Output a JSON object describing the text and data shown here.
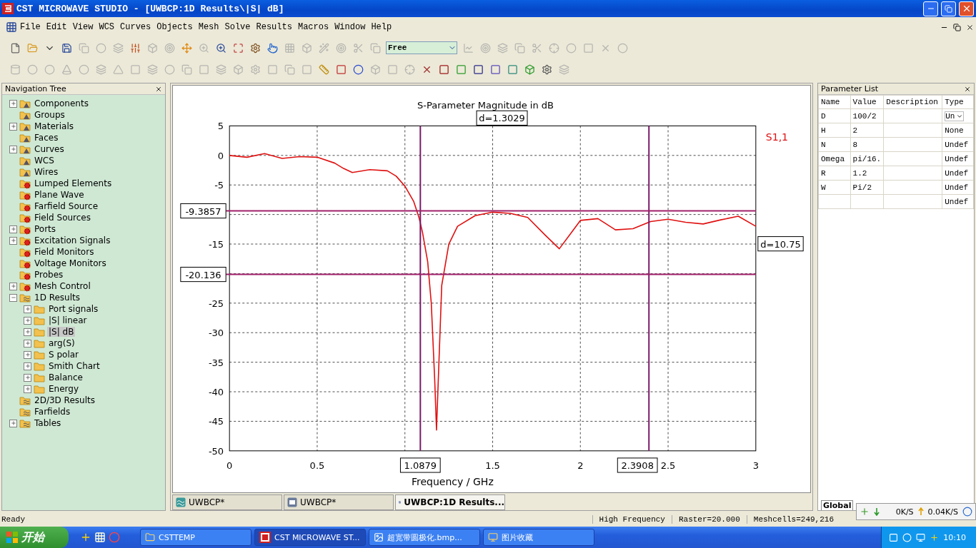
{
  "window": {
    "title": "CST MICROWAVE STUDIO - [UWBCP:1D Results\\|S| dB]"
  },
  "menu": [
    "File",
    "Edit",
    "View",
    "WCS",
    "Curves",
    "Objects",
    "Mesh",
    "Solve",
    "Results",
    "Macros",
    "Window",
    "Help"
  ],
  "toolbar": {
    "view_mode": "Free"
  },
  "navigation_tree": {
    "title": "Navigation Tree",
    "items": [
      {
        "label": "Components",
        "kind": "structure",
        "expandable": true,
        "expanded": false,
        "selected": false
      },
      {
        "label": "Groups",
        "kind": "structure",
        "expandable": false,
        "selected": false
      },
      {
        "label": "Materials",
        "kind": "structure",
        "expandable": true,
        "expanded": false,
        "selected": false
      },
      {
        "label": "Faces",
        "kind": "structure",
        "expandable": false,
        "selected": false
      },
      {
        "label": "Curves",
        "kind": "structure",
        "expandable": true,
        "expanded": false,
        "selected": false
      },
      {
        "label": "WCS",
        "kind": "structure",
        "expandable": false,
        "selected": false
      },
      {
        "label": "Wires",
        "kind": "structure",
        "expandable": false,
        "selected": false
      },
      {
        "label": "Lumped Elements",
        "kind": "source",
        "expandable": false,
        "selected": false
      },
      {
        "label": "Plane Wave",
        "kind": "source",
        "expandable": false,
        "selected": false
      },
      {
        "label": "Farfield Source",
        "kind": "source",
        "expandable": false,
        "selected": false
      },
      {
        "label": "Field Sources",
        "kind": "source",
        "expandable": false,
        "selected": false
      },
      {
        "label": "Ports",
        "kind": "source",
        "expandable": true,
        "expanded": false,
        "selected": false
      },
      {
        "label": "Excitation Signals",
        "kind": "source",
        "expandable": true,
        "expanded": false,
        "selected": false
      },
      {
        "label": "Field Monitors",
        "kind": "source",
        "expandable": false,
        "selected": false
      },
      {
        "label": "Voltage Monitors",
        "kind": "source",
        "expandable": false,
        "selected": false
      },
      {
        "label": "Probes",
        "kind": "source",
        "expandable": false,
        "selected": false
      },
      {
        "label": "Mesh Control",
        "kind": "source",
        "expandable": true,
        "expanded": false,
        "selected": false
      },
      {
        "label": "1D Results",
        "kind": "result",
        "expandable": true,
        "expanded": true,
        "selected": false,
        "children": [
          {
            "label": "Port signals",
            "kind": "folder",
            "expandable": true,
            "expanded": false,
            "selected": false
          },
          {
            "label": "|S| linear",
            "kind": "folder",
            "expandable": true,
            "expanded": false,
            "selected": false
          },
          {
            "label": "|S| dB",
            "kind": "folder",
            "expandable": true,
            "expanded": false,
            "selected": true
          },
          {
            "label": "arg(S)",
            "kind": "folder",
            "expandable": true,
            "expanded": false,
            "selected": false
          },
          {
            "label": "S polar",
            "kind": "folder",
            "expandable": true,
            "expanded": false,
            "selected": false
          },
          {
            "label": "Smith Chart",
            "kind": "folder",
            "expandable": true,
            "expanded": false,
            "selected": false
          },
          {
            "label": "Balance",
            "kind": "folder",
            "expandable": true,
            "expanded": false,
            "selected": false
          },
          {
            "label": "Energy",
            "kind": "folder",
            "expandable": true,
            "expanded": false,
            "selected": false
          }
        ]
      },
      {
        "label": "2D/3D Results",
        "kind": "result",
        "expandable": false,
        "selected": false
      },
      {
        "label": "Farfields",
        "kind": "result",
        "expandable": false,
        "selected": false
      },
      {
        "label": "Tables",
        "kind": "result",
        "expandable": true,
        "expanded": false,
        "selected": false
      }
    ]
  },
  "plot": {
    "chart_data": {
      "type": "line",
      "title": "S-Parameter Magnitude in dB",
      "xlabel": "Frequency / GHz",
      "xlim": [
        0,
        3
      ],
      "ylim": [
        -50,
        5
      ],
      "xticks": [
        0,
        0.5,
        1.5,
        2,
        2.5,
        3
      ],
      "yticks": [
        5,
        0,
        -5,
        -15,
        -25,
        -30,
        -35,
        -40,
        -45,
        -50
      ],
      "grid": true,
      "x": [
        0,
        0.1,
        0.2,
        0.3,
        0.4,
        0.5,
        0.6,
        0.65,
        0.7,
        0.8,
        0.9,
        0.95,
        1.0,
        1.05,
        1.08,
        1.1,
        1.13,
        1.15,
        1.17,
        1.18,
        1.19,
        1.21,
        1.25,
        1.3,
        1.4,
        1.5,
        1.6,
        1.7,
        1.8,
        1.88,
        1.95,
        2.0,
        2.1,
        2.2,
        2.3,
        2.4,
        2.5,
        2.6,
        2.7,
        2.8,
        2.9,
        3.0
      ],
      "series": [
        {
          "name": "S1,1",
          "color": "#e01010",
          "values": [
            0,
            -0.3,
            0.3,
            -0.5,
            -0.2,
            -0.3,
            -1.3,
            -2.2,
            -2.9,
            -2.4,
            -2.6,
            -3.5,
            -5.2,
            -7.8,
            -10.5,
            -13,
            -18,
            -25,
            -38,
            -46.5,
            -38,
            -22,
            -15,
            -12,
            -10.2,
            -9.6,
            -9.8,
            -10.5,
            -13.5,
            -15.8,
            -13,
            -11,
            -10.7,
            -12.6,
            -12.4,
            -11.2,
            -10.8,
            -11.3,
            -11.6,
            -10.9,
            -10.3,
            -12
          ]
        }
      ],
      "ref_lines": [
        {
          "axis": "x",
          "value": 1.0879,
          "label": "1.0879",
          "color": "#7a1a6a"
        },
        {
          "axis": "x",
          "value": 2.3908,
          "label": "2.3908",
          "color": "#7a1a6a"
        },
        {
          "axis": "y",
          "value": -9.3857,
          "label": "-9.3857",
          "color": "#a0206a"
        },
        {
          "axis": "y",
          "value": -20.136,
          "label": "-20.136",
          "color": "#a0206a"
        }
      ]
    },
    "marker_deltas": {
      "x": "d=1.3029",
      "y": "d=10.75"
    }
  },
  "document_tabs": [
    {
      "label": "UWBCP*",
      "kind": "model",
      "selected": false
    },
    {
      "label": "UWBCP*",
      "kind": "schematic",
      "selected": false
    },
    {
      "label": "UWBCP:1D Results...",
      "kind": "results",
      "selected": true
    }
  ],
  "parameter_list": {
    "title": "Parameter List",
    "columns": [
      "Name",
      "Value",
      "Description",
      "Type"
    ],
    "rows": [
      {
        "name": "D",
        "value": "100/2",
        "description": "",
        "type": "Un",
        "dropdown": true
      },
      {
        "name": "H",
        "value": "2",
        "type": "None",
        "dropdown": false
      },
      {
        "name": "N",
        "value": "8",
        "type": "Undef",
        "dropdown": false
      },
      {
        "name": "Omega",
        "value": "pi/16.",
        "type": "Undef",
        "dropdown": false
      },
      {
        "name": "R",
        "value": "1.2",
        "type": "Undef",
        "dropdown": false
      },
      {
        "name": "W",
        "value": "Pi/2",
        "type": "Undef",
        "dropdown": false
      },
      {
        "name": "",
        "value": "",
        "type": "Undef",
        "dropdown": false
      }
    ],
    "tab": "Global"
  },
  "status_bar": {
    "message": "Ready",
    "fields": [
      "High Frequency",
      "Raster=20.000",
      "Meshcells=249,216"
    ]
  },
  "net_monitor": {
    "down": "0K/S",
    "up": "0.04K/S"
  },
  "taskbar": {
    "start": "开始",
    "tasks": [
      {
        "label": "CSTTEMP",
        "kind": "folder",
        "selected": false
      },
      {
        "label": "CST MICROWAVE ST...",
        "kind": "app",
        "selected": true
      },
      {
        "label": "超宽带圆极化.bmp...",
        "kind": "image",
        "selected": false
      },
      {
        "label": "图片收藏",
        "kind": "gallery",
        "selected": false
      }
    ],
    "clock": "10:10"
  }
}
